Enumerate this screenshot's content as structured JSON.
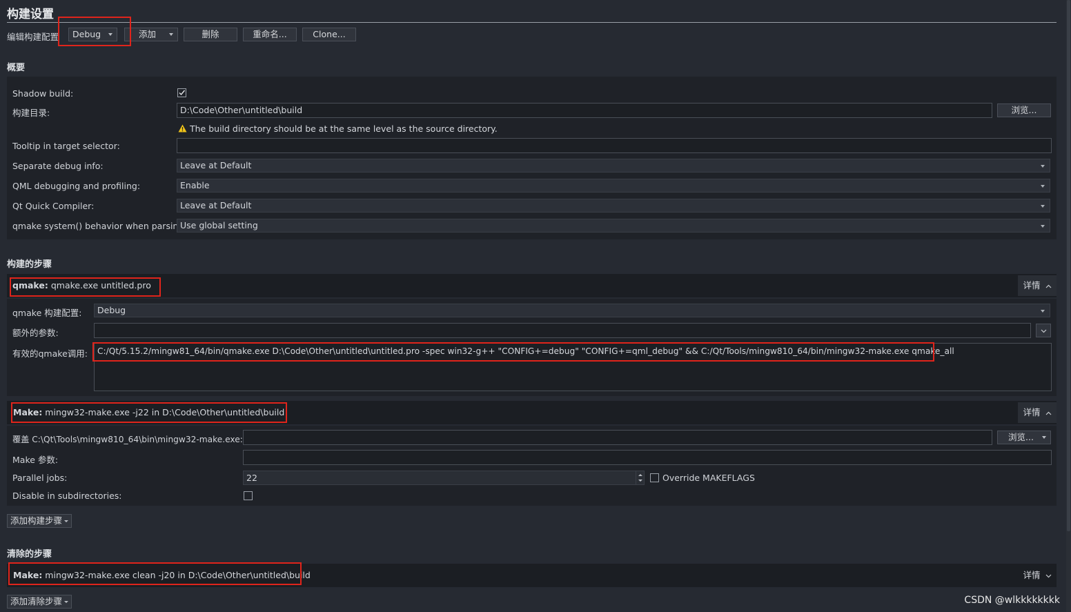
{
  "title": "构建设置",
  "toolbar": {
    "edit_config_label": "编辑构建配置",
    "config_value": "Debug",
    "add_label": "添加",
    "delete_label": "删除",
    "rename_label": "重命名...",
    "clone_label": "Clone..."
  },
  "overview": {
    "header": "概要",
    "shadow_build_label": "Shadow build:",
    "shadow_build_checked": true,
    "build_dir_label": "构建目录:",
    "build_dir_value": "D:\\Code\\Other\\untitled\\build",
    "browse_label": "浏览...",
    "warning_text": "The build directory should be at the same level as the source directory.",
    "tooltip_label": "Tooltip in target selector:",
    "tooltip_value": "",
    "sep_debug_label": "Separate debug info:",
    "sep_debug_value": "Leave at Default",
    "qml_debug_label": "QML debugging and profiling:",
    "qml_debug_value": "Enable",
    "qt_quick_label": "Qt Quick Compiler:",
    "qt_quick_value": "Leave at Default",
    "qmake_sys_label": "qmake system() behavior when parsing:",
    "qmake_sys_value": "Use global setting"
  },
  "build_steps": {
    "header": "构建的步骤",
    "qmake": {
      "title_bold": "qmake:",
      "title_rest": " qmake.exe untitled.pro",
      "details_label": "详情",
      "config_label": "qmake 构建配置:",
      "config_value": "Debug",
      "extra_args_label": "额外的参数:",
      "extra_args_value": "",
      "effective_label": "有效的qmake调用:",
      "effective_value": "C:/Qt/5.15.2/mingw81_64/bin/qmake.exe D:\\Code\\Other\\untitled\\untitled.pro -spec win32-g++ \"CONFIG+=debug\" \"CONFIG+=qml_debug\" && C:/Qt/Tools/mingw810_64/bin/mingw32-make.exe qmake_all"
    },
    "make": {
      "title_bold": "Make:",
      "title_rest": " mingw32-make.exe -j22 in D:\\Code\\Other\\untitled\\build",
      "details_label": "详情",
      "override_label": "覆盖 C:\\Qt\\Tools\\mingw810_64\\bin\\mingw32-make.exe:",
      "override_value": "",
      "browse_label": "浏览...",
      "make_args_label": "Make 参数:",
      "make_args_value": "",
      "parallel_label": "Parallel jobs:",
      "parallel_value": "22",
      "override_makeflags_label": "Override MAKEFLAGS",
      "disable_subdirs_label": "Disable in subdirectories:"
    },
    "add_step_label": "添加构建步骤"
  },
  "clean_steps": {
    "header": "清除的步骤",
    "make": {
      "title_bold": "Make:",
      "title_rest": " mingw32-make.exe clean -j20 in D:\\Code\\Other\\untitled\\build",
      "details_label": "详情"
    },
    "add_step_label": "添加清除步骤"
  },
  "watermark": "CSDN @wlkkkkkkkk"
}
